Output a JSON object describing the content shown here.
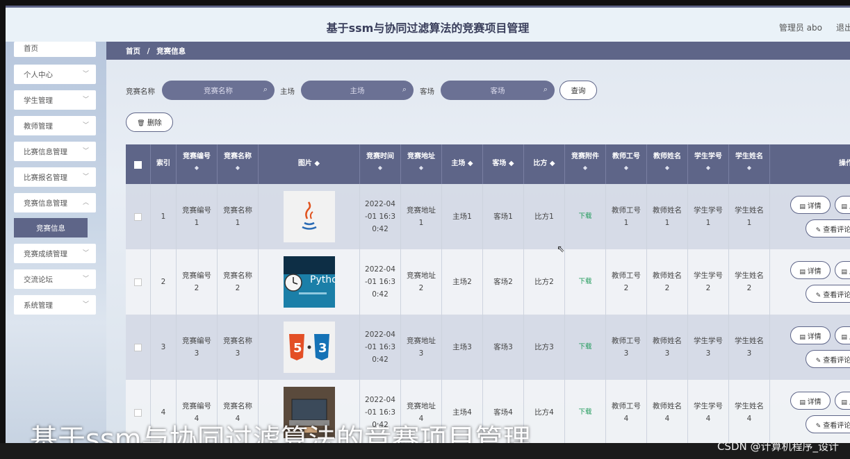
{
  "header": {
    "title": "基于ssm与协同过滤算法的竞赛项目管理",
    "user": "管理员 abo",
    "logout": "退出"
  },
  "sidebar": {
    "items": [
      {
        "label": "首页"
      },
      {
        "label": "个人中心"
      },
      {
        "label": "学生管理"
      },
      {
        "label": "教师管理"
      },
      {
        "label": "比赛信息管理"
      },
      {
        "label": "比赛报名管理"
      },
      {
        "label": "竞赛信息管理"
      },
      {
        "label": "竞赛成绩管理"
      },
      {
        "label": "交流论坛"
      },
      {
        "label": "系统管理"
      }
    ],
    "active_sub": "竞赛信息"
  },
  "breadcrumb": {
    "home": "首页",
    "sep": "/",
    "current": "竞赛信息"
  },
  "search": {
    "name_label": "竞赛名称",
    "name_placeholder": "竞赛名称",
    "home_label": "主场",
    "home_placeholder": "主场",
    "away_label": "客场",
    "away_placeholder": "客场",
    "query_button": "查询"
  },
  "toolbar": {
    "delete_button": "删除"
  },
  "table": {
    "headers": {
      "index": "索引",
      "code": "竞赛编号",
      "name": "竞赛名称",
      "image": "图片 ◆",
      "time": "竞赛时间",
      "place": "竞赛地址",
      "home": "主场 ◆",
      "away": "客场 ◆",
      "score": "比方 ◆",
      "attach": "竞赛附件",
      "teacher_no": "教师工号",
      "teacher_name": "教师姓名",
      "student_no": "学生学号",
      "student_name": "学生姓名",
      "ops": "操作"
    },
    "sort_glyph": "◆",
    "rows": [
      {
        "index": "1",
        "code": "竞赛编号\n1",
        "name": "竞赛名称\n1",
        "image": "java",
        "time": "2022-04\n-01 16:3\n0:42",
        "place": "竞赛地址\n1",
        "home": "主场1",
        "away": "客场1",
        "score": "比方1",
        "attach": "下载",
        "teacher_no": "教师工号\n1",
        "teacher_name": "教师姓名\n1",
        "student_no": "学生学号\n1",
        "student_name": "学生姓名\n1"
      },
      {
        "index": "2",
        "code": "竞赛编号\n2",
        "name": "竞赛名称\n2",
        "image": "python",
        "time": "2022-04\n-01 16:3\n0:42",
        "place": "竞赛地址\n2",
        "home": "主场2",
        "away": "客场2",
        "score": "比方2",
        "attach": "下载",
        "teacher_no": "教师工号\n2",
        "teacher_name": "教师姓名\n2",
        "student_no": "学生学号\n2",
        "student_name": "学生姓名\n2"
      },
      {
        "index": "3",
        "code": "竞赛编号\n3",
        "name": "竞赛名称\n3",
        "image": "html5-css3",
        "time": "2022-04\n-01 16:3\n0:42",
        "place": "竞赛地址\n3",
        "home": "主场3",
        "away": "客场3",
        "score": "比方3",
        "attach": "下载",
        "teacher_no": "教师工号\n3",
        "teacher_name": "教师姓名\n3",
        "student_no": "学生学号\n3",
        "student_name": "学生姓名\n3"
      },
      {
        "index": "4",
        "code": "竞赛编号\n4",
        "name": "竞赛名称\n4",
        "image": "laptop",
        "time": "2022-04\n-01 16:3\n0:42",
        "place": "竞赛地址\n4",
        "home": "主场4",
        "away": "客场4",
        "score": "比方4",
        "attach": "下载",
        "teacher_no": "教师工号\n4",
        "teacher_name": "教师姓名\n4",
        "student_no": "学生学号\n4",
        "student_name": "学生姓名\n4"
      }
    ],
    "ops": {
      "detail": "详情",
      "edit": "反",
      "comment": "查看评论"
    }
  },
  "overlay": {
    "caption": "基于ssm与协同过滤算法的竞赛项目管理",
    "watermark": "CSDN @计算机程序_设计"
  },
  "colors": {
    "accent": "#5e6588",
    "download": "#1f9a5a"
  }
}
